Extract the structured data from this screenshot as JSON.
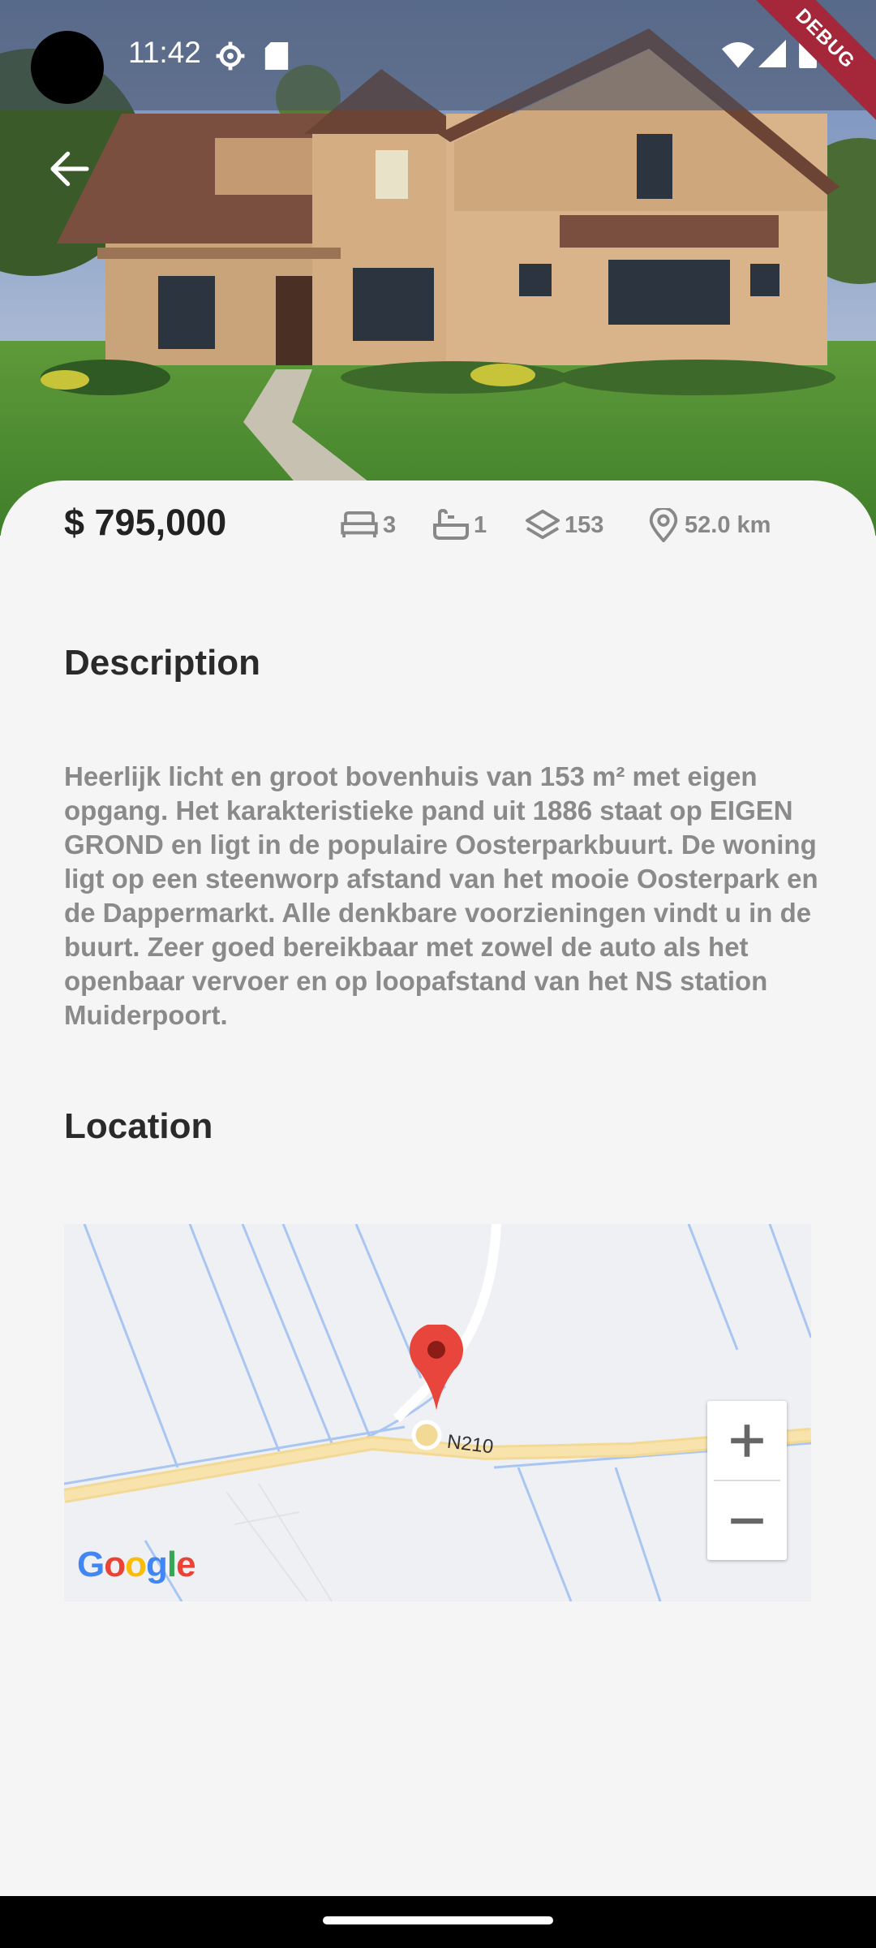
{
  "status_bar": {
    "time": "11:42",
    "debug_label": "DEBUG"
  },
  "listing": {
    "price": "$ 795,000",
    "bedrooms": "3",
    "bathrooms": "1",
    "size": "153",
    "distance": "52.0 km"
  },
  "description": {
    "heading": "Description",
    "text": "Heerlijk licht en groot bovenhuis van 153 m² met eigen opgang. Het karakteristieke pand uit 1886 staat op EIGEN GROND en ligt in de populaire Oosterparkbuurt. De woning ligt op een steenworp afstand van het mooie Oosterpark en de Dappermarkt. Alle denkbare voorzieningen vindt u in de buurt. Zeer goed bereikbaar met zowel de auto als het openbaar vervoer en op loopafstand van het NS station Muiderpoort."
  },
  "location": {
    "heading": "Location",
    "road_label": "N210",
    "map_brand": [
      "G",
      "o",
      "o",
      "g",
      "l",
      "e"
    ],
    "brand_colors": [
      "#4285F4",
      "#EA4335",
      "#FBBC05",
      "#4285F4",
      "#34A853",
      "#EA4335"
    ]
  },
  "icons": [
    "back-arrow-icon",
    "settings-icon",
    "sd-card-icon",
    "wifi-icon",
    "signal-icon",
    "battery-icon",
    "bed-icon",
    "bathtub-icon",
    "layers-icon",
    "location-pin-icon",
    "map-marker-icon",
    "zoom-in-icon",
    "zoom-out-icon"
  ]
}
